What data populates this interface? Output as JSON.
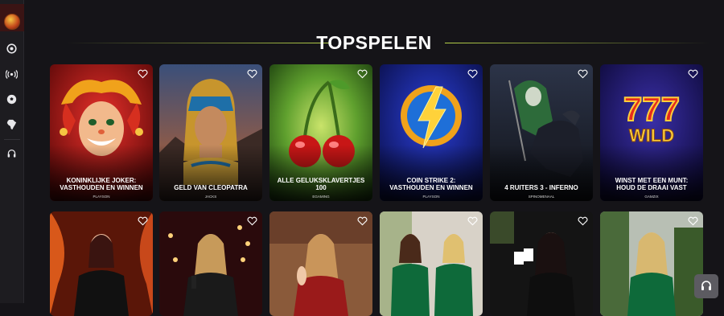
{
  "sidebar": {
    "logo": "casino-logo",
    "icons": [
      "casino-chip-icon",
      "live-broadcast-icon",
      "soccer-ball-icon",
      "africa-map-icon",
      "headset-support-icon"
    ]
  },
  "section": {
    "title": "TOPSPELEN"
  },
  "games_row1": [
    {
      "name": "KONINKLIJKE JOKER: VASTHOUDEN EN WINNEN",
      "provider": "PLAYSON"
    },
    {
      "name": "GELD VAN CLEOPATRA",
      "provider": "JACKS"
    },
    {
      "name": "ALLE GELUKSKLAVERTJES 100",
      "provider": "EGAMING"
    },
    {
      "name": "COIN STRIKE 2: VASTHOUDEN EN WINNEN",
      "provider": "PLAYSON"
    },
    {
      "name": "4 RUITERS 3 - INFERNO",
      "provider": "SPINOMENAAL"
    },
    {
      "name": "WINST MET EEN MUNT: HOUD DE DRAAI VAST",
      "provider": "GAMZIX"
    }
  ],
  "games_row2": [
    {
      "theme": "live-dealer-red-fire"
    },
    {
      "theme": "live-dealer-stage-lights"
    },
    {
      "theme": "live-dealer-warm-room"
    },
    {
      "theme": "live-dealer-green-dresses"
    },
    {
      "theme": "live-dealer-cards"
    },
    {
      "theme": "live-dealer-green-room"
    }
  ],
  "support_button": {
    "icon": "headset-icon"
  },
  "colors": {
    "background": "#151418",
    "accent_line": "#b7d34a",
    "sidebar": "#1d1c20"
  }
}
